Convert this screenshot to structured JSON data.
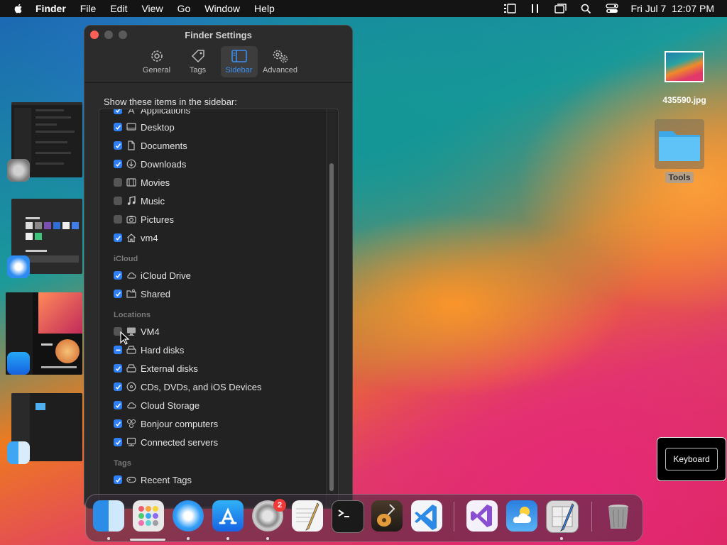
{
  "menubar": {
    "app_name": "Finder",
    "items": [
      "File",
      "Edit",
      "View",
      "Go",
      "Window",
      "Help"
    ],
    "datetime": "Fri Jul 7  12:07 PM"
  },
  "window": {
    "title": "Finder Settings",
    "tabs": [
      {
        "label": "General",
        "icon": "gear-icon",
        "active": false
      },
      {
        "label": "Tags",
        "icon": "tag-icon",
        "active": false
      },
      {
        "label": "Sidebar",
        "icon": "sidebar-icon",
        "active": true
      },
      {
        "label": "Advanced",
        "icon": "gears-icon",
        "active": false
      }
    ],
    "heading": "Show these items in the sidebar:",
    "sections": {
      "icloud": "iCloud",
      "locations": "Locations",
      "tags": "Tags"
    },
    "items": [
      {
        "label": "Applications",
        "state": "on",
        "icon": "applications-icon"
      },
      {
        "label": "Desktop",
        "state": "on",
        "icon": "desktop-icon"
      },
      {
        "label": "Documents",
        "state": "on",
        "icon": "document-icon"
      },
      {
        "label": "Downloads",
        "state": "on",
        "icon": "download-icon"
      },
      {
        "label": "Movies",
        "state": "off",
        "icon": "film-icon"
      },
      {
        "label": "Music",
        "state": "off",
        "icon": "music-icon"
      },
      {
        "label": "Pictures",
        "state": "off",
        "icon": "camera-icon"
      },
      {
        "label": "vm4",
        "state": "on",
        "icon": "home-icon"
      },
      {
        "label": "iCloud Drive",
        "state": "on",
        "icon": "cloud-icon"
      },
      {
        "label": "Shared",
        "state": "on",
        "icon": "shared-folder-icon"
      },
      {
        "label": "VM4",
        "state": "off",
        "icon": "computer-icon"
      },
      {
        "label": "Hard disks",
        "state": "mixed",
        "icon": "disk-icon"
      },
      {
        "label": "External disks",
        "state": "on",
        "icon": "external-disk-icon"
      },
      {
        "label": "CDs, DVDs, and iOS Devices",
        "state": "on",
        "icon": "disc-icon"
      },
      {
        "label": "Cloud Storage",
        "state": "on",
        "icon": "cloud-icon"
      },
      {
        "label": "Bonjour computers",
        "state": "on",
        "icon": "bonjour-icon"
      },
      {
        "label": "Connected servers",
        "state": "on",
        "icon": "server-icon"
      },
      {
        "label": "Recent Tags",
        "state": "on",
        "icon": "tag-icon"
      }
    ]
  },
  "desktop": {
    "file_label": "435590.jpg",
    "folder_label": "Tools",
    "tooltip": "Keyboard"
  },
  "dock": {
    "settings_badge": "2"
  },
  "colors": {
    "accent": "#2f7ff5",
    "close": "#ff5f57",
    "badge": "#ef3a3a"
  }
}
